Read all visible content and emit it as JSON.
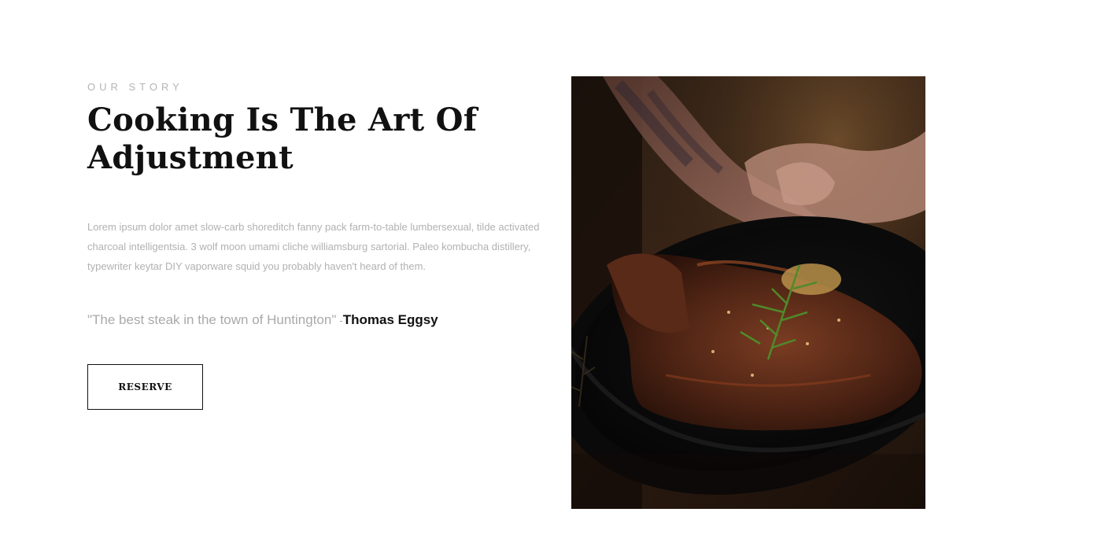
{
  "section": {
    "eyebrow": "OUR STORY",
    "title": "Cooking Is The Art Of Adjustment",
    "description": "Lorem ipsum dolor amet slow-carb shoreditch fanny pack farm-to-table lumbersexual, tilde activated charcoal intelligentsia. 3 wolf moon umami cliche williamsburg sartorial. Paleo kombucha distillery, typewriter keytar DIY vaporware squid you probably haven't heard of them.",
    "quote": {
      "text": "\"The best steak in the town of Huntington\"",
      "dash": "-",
      "author": "Thomas Eggsy"
    },
    "button_label": "RESERVE"
  },
  "photo": {
    "subject": "steak-in-cast-iron-pan"
  },
  "colors": {
    "heading": "#111111",
    "muted_text": "#b1b1b1",
    "background": "#ffffff"
  }
}
